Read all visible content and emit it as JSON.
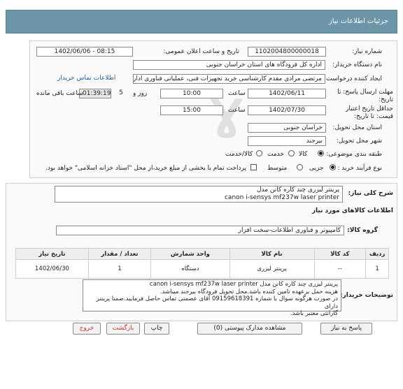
{
  "header": {
    "title": "جزئیات اطلاعات نیاز"
  },
  "form": {
    "need_number": {
      "label": "شماره نیاز:",
      "value": "1102004800000018"
    },
    "announce_datetime": {
      "label": "تاریخ و ساعت اعلان عمومی:",
      "value": "1402/06/06 - 08:15"
    },
    "buyer_org": {
      "label": "نام دستگاه خریدار:",
      "value": "اداره کل فرودگاه های استان خراسان جنوبی"
    },
    "requester": {
      "label": "ایجاد کننده درخواست:",
      "value": "مرتضی مرادی مقدم کارشناسی خرید تجهیزات فنی، عملیاتی فناوری اداره کل فرو",
      "contact_link": "اطلاعات تماس خریدار"
    },
    "send_deadline": {
      "label": "مهلت ارسال پاسخ: تا تاریخ:",
      "date": "1402/06/11",
      "time_label": "ساعت",
      "time": "10:00",
      "days": "5",
      "days_label": "روز و",
      "remaining": "01:39:19",
      "remaining_label": "ساعت باقی مانده"
    },
    "price_validity": {
      "label": "حداقل تاریخ اعتبار قیمت: تا تاریخ:",
      "date": "1402/07/30",
      "time_label": "ساعت",
      "time": "15:00"
    },
    "province": {
      "label": "استان محل تحویل:",
      "value": "خراسان جنوبی"
    },
    "city": {
      "label": "شهر محل تحویل:",
      "value": "بیرجند"
    },
    "category": {
      "label": "طبقه بندی موضوعی:",
      "options": [
        "کالا",
        "خدمت",
        "کالا/خدمت"
      ],
      "selected": 0
    },
    "process": {
      "label": "نوع فرآیند خرید :",
      "options": [
        "جزیی",
        "متوسط"
      ],
      "selected": 0,
      "note": "پرداخت تمام یا بخشی از مبلغ خرید،از محل \"اسناد خزانه اسلامی\" خواهد بود."
    }
  },
  "summary": {
    "label": "شرح کلی نیاز:",
    "line1": "پرینتر لیزری چند کاره کانن مدل",
    "line2": "canon i-sensys mf237w laser printer"
  },
  "goods_section": {
    "title": "اطلاعات کالاهای مورد نیاز"
  },
  "goods_group": {
    "label": "گروه کالا:",
    "value": "کامپیوتر و فناوری اطلاعات-سخت افزار"
  },
  "table": {
    "headers": [
      "ردیف",
      "کد کالا",
      "نام کالا",
      "واحد شمارش",
      "تعداد / مقدار",
      "تاریخ نیاز"
    ],
    "rows": [
      [
        "1",
        "--",
        "پرینتر لیزری",
        "دستگاه",
        "1",
        "1402/06/30"
      ]
    ]
  },
  "buyer_notes": {
    "label": "توضیحات خریدار:",
    "text": "پرینتر لیزری چند کاره کانن مدل canon i-sensys mf237w laser printer\nهزینه حمل برعهده تامین کننده باشد.محل تحویل فرودگاه بیرجند میباشد.\nدر صورت هرگونه سوال با شماره 09159618391 آقای عصمتی تماس حاصل فرمایید.ضمنا پرینتر دارای\nگارانتی معتبر باشد."
  },
  "actions": {
    "reply": "پاسخ به نیاز",
    "attachments": "مشاهده مدارک پیوستی (0)",
    "print": "چاپ",
    "back": "بازگشت",
    "exit": "خروج"
  }
}
